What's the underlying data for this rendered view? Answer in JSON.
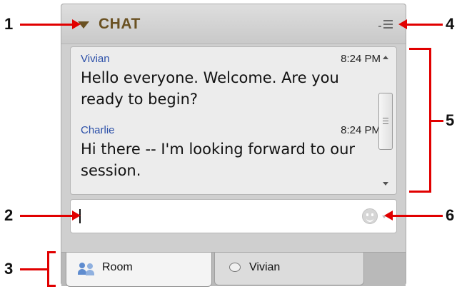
{
  "header": {
    "title": "CHAT"
  },
  "messages": [
    {
      "sender": "Vivian",
      "time": "8:24 PM",
      "text": "Hello everyone. Welcome. Are you ready to begin?"
    },
    {
      "sender": "Charlie",
      "time": "8:24 PM",
      "text": "Hi there -- I'm looking forward to our session."
    }
  ],
  "input": {
    "value": ""
  },
  "tabs": [
    {
      "label": "Room",
      "icon": "people-icon",
      "active": true
    },
    {
      "label": "Vivian",
      "icon": "chat-bubble-icon",
      "active": false
    }
  ],
  "callouts": [
    "1",
    "2",
    "3",
    "4",
    "5",
    "6"
  ],
  "colors": {
    "title": "#6a5122",
    "sender_name": "#2b4fa8",
    "callout_arrow": "#e10000"
  }
}
